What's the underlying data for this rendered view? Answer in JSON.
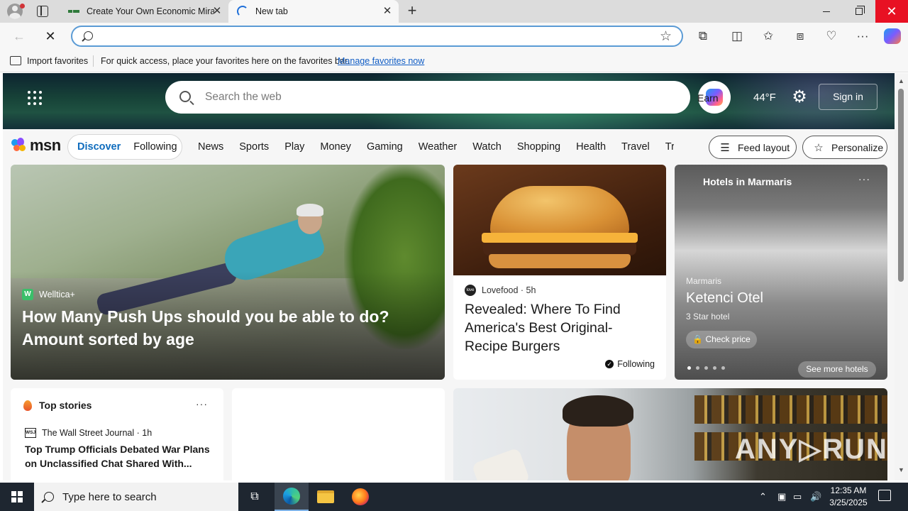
{
  "browser": {
    "tabs": [
      {
        "title": "Create Your Own Economic Mira",
        "active": false
      },
      {
        "title": "New tab",
        "active": true
      }
    ],
    "address_value": "",
    "new_tab_glyph": "+",
    "favorites_bar": {
      "import_label": "Import favorites",
      "hint": "For quick access, place your favorites here on the favorites bar.",
      "manage_link": "Manage favorites now"
    }
  },
  "msn_header": {
    "search_placeholder": "Search the web",
    "earn_text": "Earn",
    "weather": "44°F",
    "sign_in": "Sign in"
  },
  "msn_nav": {
    "logo_text": "msn",
    "pills": [
      "Discover",
      "Following"
    ],
    "categories": [
      "News",
      "Sports",
      "Play",
      "Money",
      "Gaming",
      "Weather",
      "Watch",
      "Shopping",
      "Health",
      "Travel",
      "Traf"
    ],
    "feed_layout": "Feed layout",
    "personalize": "Personalize"
  },
  "cards": {
    "hero": {
      "source": "Welltica+",
      "source_logo": "W",
      "title": "How Many Push Ups should you be able to do? Amount sorted by age"
    },
    "burger": {
      "source": "Lovefood",
      "age": "5h",
      "title": "Revealed: Where To Find America's Best Original-Recipe Burgers",
      "following": "Following"
    },
    "hotel": {
      "header": "Hotels in Marmaris",
      "location": "Marmaris",
      "name": "Ketenci Otel",
      "stars": "3 Star hotel",
      "check_price": "Check price",
      "see_more": "See more hotels"
    },
    "top_stories": {
      "header": "Top stories",
      "source": "The Wall Street Journal",
      "age": "1h",
      "source_logo": "WSJ",
      "title": "Top Trump Officials Debated War Plans on Unclassified Chat Shared With..."
    }
  },
  "watermark": "ANY▷RUN",
  "taskbar": {
    "search_placeholder": "Type here to search",
    "time": "12:35 AM",
    "date": "3/25/2025"
  },
  "colors": {
    "accent": "#0f6cbd",
    "close_red": "#e81123",
    "address_border": "#5b9bd5"
  }
}
